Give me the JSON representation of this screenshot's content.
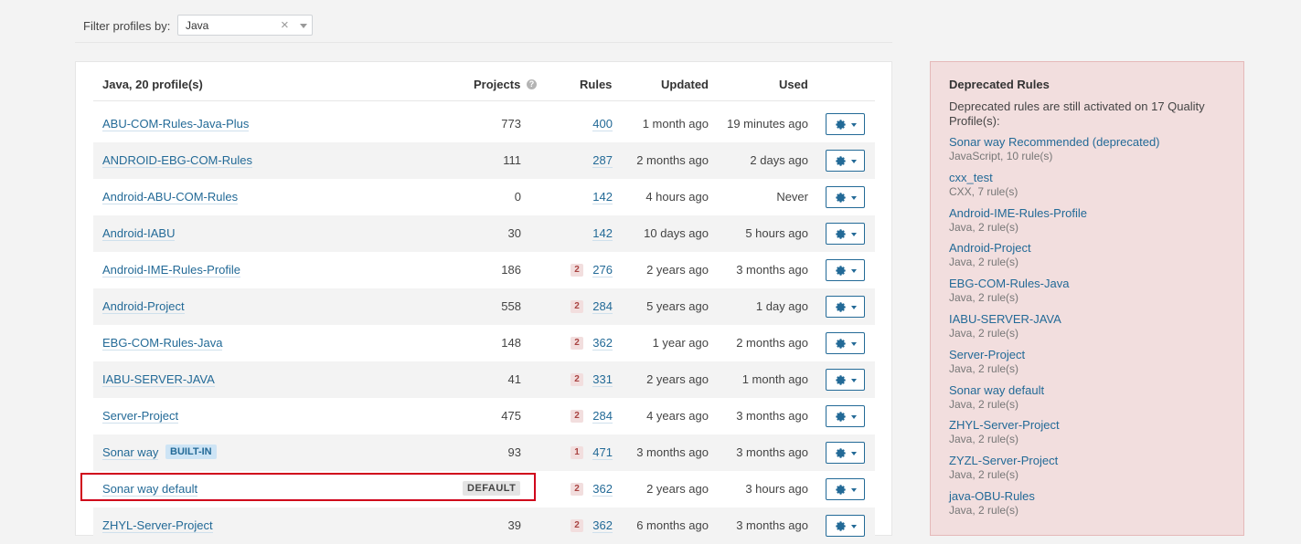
{
  "filter": {
    "label": "Filter profiles by:",
    "value": "Java",
    "clear_glyph": "×"
  },
  "table": {
    "title": "Java, 20 profile(s)",
    "col_projects": "Projects",
    "help_glyph": "?",
    "col_rules": "Rules",
    "col_updated": "Updated",
    "col_used": "Used",
    "rows": [
      {
        "name": "ABU-COM-Rules-Java-Plus",
        "projects": "773",
        "deprecated": "",
        "rules": "400",
        "updated": "1 month ago",
        "used": "19 minutes ago"
      },
      {
        "name": "ANDROID-EBG-COM-Rules",
        "projects": "111",
        "deprecated": "",
        "rules": "287",
        "updated": "2 months ago",
        "used": "2 days ago"
      },
      {
        "name": "Android-ABU-COM-Rules",
        "projects": "0",
        "deprecated": "",
        "rules": "142",
        "updated": "4 hours ago",
        "used": "Never"
      },
      {
        "name": "Android-IABU",
        "projects": "30",
        "deprecated": "",
        "rules": "142",
        "updated": "10 days ago",
        "used": "5 hours ago"
      },
      {
        "name": "Android-IME-Rules-Profile",
        "projects": "186",
        "deprecated": "2",
        "rules": "276",
        "updated": "2 years ago",
        "used": "3 months ago"
      },
      {
        "name": "Android-Project",
        "projects": "558",
        "deprecated": "2",
        "rules": "284",
        "updated": "5 years ago",
        "used": "1 day ago"
      },
      {
        "name": "EBG-COM-Rules-Java",
        "projects": "148",
        "deprecated": "2",
        "rules": "362",
        "updated": "1 year ago",
        "used": "2 months ago"
      },
      {
        "name": "IABU-SERVER-JAVA",
        "projects": "41",
        "deprecated": "2",
        "rules": "331",
        "updated": "2 years ago",
        "used": "1 month ago"
      },
      {
        "name": "Server-Project",
        "projects": "475",
        "deprecated": "2",
        "rules": "284",
        "updated": "4 years ago",
        "used": "3 months ago"
      },
      {
        "name": "Sonar way",
        "badge": "BUILT-IN",
        "projects": "93",
        "deprecated": "1",
        "rules": "471",
        "updated": "3 months ago",
        "used": "3 months ago"
      },
      {
        "name": "Sonar way default",
        "badge": "DEFAULT",
        "projects": "",
        "deprecated": "2",
        "rules": "362",
        "updated": "2 years ago",
        "used": "3 hours ago"
      },
      {
        "name": "ZHYL-Server-Project",
        "projects": "39",
        "deprecated": "2",
        "rules": "362",
        "updated": "6 months ago",
        "used": "3 months ago"
      }
    ]
  },
  "deprecated": {
    "title": "Deprecated Rules",
    "description": "Deprecated rules are still activated on 17 Quality Profile(s):",
    "items": [
      {
        "name": "Sonar way Recommended (deprecated)",
        "meta": "JavaScript, 10 rule(s)"
      },
      {
        "name": "cxx_test",
        "meta": "CXX, 7 rule(s)"
      },
      {
        "name": "Android-IME-Rules-Profile",
        "meta": "Java, 2 rule(s)"
      },
      {
        "name": "Android-Project",
        "meta": "Java, 2 rule(s)"
      },
      {
        "name": "EBG-COM-Rules-Java",
        "meta": "Java, 2 rule(s)"
      },
      {
        "name": "IABU-SERVER-JAVA",
        "meta": "Java, 2 rule(s)"
      },
      {
        "name": "Server-Project",
        "meta": "Java, 2 rule(s)"
      },
      {
        "name": "Sonar way default",
        "meta": "Java, 2 rule(s)"
      },
      {
        "name": "ZHYL-Server-Project",
        "meta": "Java, 2 rule(s)"
      },
      {
        "name": "ZYZL-Server-Project",
        "meta": "Java, 2 rule(s)"
      },
      {
        "name": "java-OBU-Rules",
        "meta": "Java, 2 rule(s)"
      }
    ]
  },
  "colors": {
    "link": "#236a97",
    "deprecated_bg": "#f2dede",
    "highlight": "#d0021b"
  }
}
